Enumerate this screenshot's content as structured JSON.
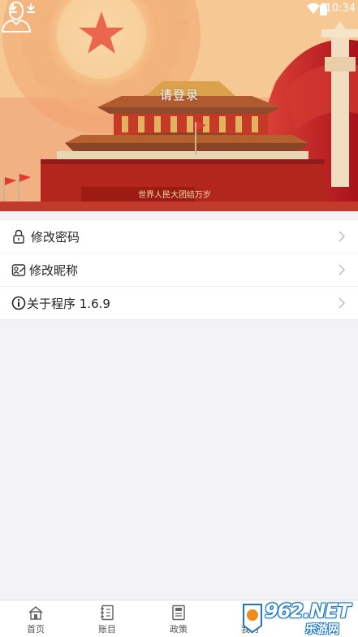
{
  "status_bar": {
    "time": "10:34"
  },
  "header": {
    "login_label": "请登录",
    "banner_text": "世界人民大团结万岁"
  },
  "menu": {
    "items": [
      {
        "label": "修改密码",
        "icon": "lock-icon"
      },
      {
        "label": "修改昵称",
        "icon": "edit-icon"
      },
      {
        "label": "关于程序 1.6.9",
        "icon": "info-icon"
      }
    ]
  },
  "tabbar": {
    "tabs": [
      {
        "label": "首页",
        "icon": "home-icon"
      },
      {
        "label": "账目",
        "icon": "ledger-icon"
      },
      {
        "label": "政策",
        "icon": "policy-icon"
      },
      {
        "label": "我的",
        "icon": "user-icon"
      }
    ]
  },
  "watermark": {
    "main": "962.NET",
    "sub": "乐游网"
  },
  "colors": {
    "hero_top": "#f3c28b",
    "hero_bottom": "#c33a2a",
    "gate_red": "#b3261e",
    "watermark_blue": "#1b78c8"
  }
}
